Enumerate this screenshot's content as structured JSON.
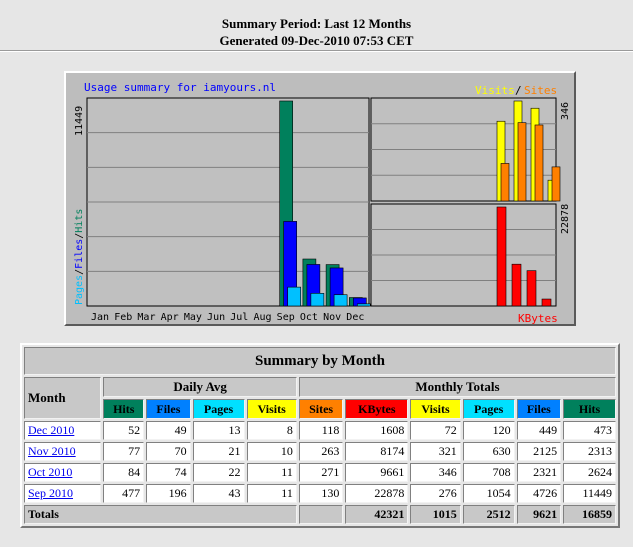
{
  "header": {
    "line1": "Summary Period: Last 12 Months",
    "line2": "Generated 09-Dec-2010 07:53 CET"
  },
  "chart": {
    "title": "Usage summary for iamyours.nl",
    "legend_visits": "Visits",
    "legend_sep": "/",
    "legend_sites": "Sites",
    "left_axis": [
      "Pages",
      "/",
      "Files",
      "/",
      "Hits"
    ],
    "bottom_right_label": "KBytes",
    "colors": {
      "hits": "#00805c",
      "files": "#0000ff",
      "pages": "#00c0ff",
      "visits": "#ffff00",
      "sites": "#ff8000",
      "kbytes": "#ff0000",
      "title": "#0000ff"
    }
  },
  "chart_data": [
    {
      "type": "bar",
      "title": "Usage summary for iamyours.nl",
      "categories": [
        "Jan",
        "Feb",
        "Mar",
        "Apr",
        "May",
        "Jun",
        "Jul",
        "Aug",
        "Sep",
        "Oct",
        "Nov",
        "Dec"
      ],
      "ylim": [
        0,
        11449
      ],
      "ymax_label": "11449",
      "series": [
        {
          "name": "Hits",
          "values": [
            0,
            0,
            0,
            0,
            0,
            0,
            0,
            0,
            11449,
            2624,
            2313,
            473
          ]
        },
        {
          "name": "Files",
          "values": [
            0,
            0,
            0,
            0,
            0,
            0,
            0,
            0,
            4726,
            2321,
            2125,
            449
          ]
        },
        {
          "name": "Pages",
          "values": [
            0,
            0,
            0,
            0,
            0,
            0,
            0,
            0,
            1054,
            708,
            630,
            120
          ]
        }
      ]
    },
    {
      "type": "bar",
      "categories": [
        "Sep",
        "Oct",
        "Nov",
        "Dec"
      ],
      "ylim": [
        0,
        346
      ],
      "ymax_label": "346",
      "series": [
        {
          "name": "Visits",
          "values": [
            276,
            346,
            321,
            72
          ]
        },
        {
          "name": "Sites",
          "values": [
            130,
            271,
            263,
            118
          ]
        }
      ]
    },
    {
      "type": "bar",
      "categories": [
        "Sep",
        "Oct",
        "Nov",
        "Dec"
      ],
      "ylim": [
        0,
        22878
      ],
      "ymax_label": "22878",
      "series": [
        {
          "name": "KBytes",
          "values": [
            22878,
            9661,
            8174,
            1608
          ]
        }
      ]
    }
  ],
  "table": {
    "title": "Summary by Month",
    "month_header": "Month",
    "daily_avg": "Daily Avg",
    "monthly_totals": "Monthly Totals",
    "daily_cols": [
      {
        "label": "Hits",
        "color": "#00805c"
      },
      {
        "label": "Files",
        "color": "#0080ff"
      },
      {
        "label": "Pages",
        "color": "#00e0ff"
      },
      {
        "label": "Visits",
        "color": "#ffff00"
      }
    ],
    "monthly_cols": [
      {
        "label": "Sites",
        "color": "#ff8000"
      },
      {
        "label": "KBytes",
        "color": "#ff0000"
      },
      {
        "label": "Visits",
        "color": "#ffff00"
      },
      {
        "label": "Pages",
        "color": "#00e0ff"
      },
      {
        "label": "Files",
        "color": "#0080ff"
      },
      {
        "label": "Hits",
        "color": "#00805c"
      }
    ],
    "rows": [
      {
        "month": "Dec 2010",
        "vals": [
          "52",
          "49",
          "13",
          "8",
          "118",
          "1608",
          "72",
          "120",
          "449",
          "473"
        ]
      },
      {
        "month": "Nov 2010",
        "vals": [
          "77",
          "70",
          "21",
          "10",
          "263",
          "8174",
          "321",
          "630",
          "2125",
          "2313"
        ]
      },
      {
        "month": "Oct 2010",
        "vals": [
          "84",
          "74",
          "22",
          "11",
          "271",
          "9661",
          "346",
          "708",
          "2321",
          "2624"
        ]
      },
      {
        "month": "Sep 2010",
        "vals": [
          "477",
          "196",
          "43",
          "11",
          "130",
          "22878",
          "276",
          "1054",
          "4726",
          "11449"
        ]
      }
    ],
    "totals": {
      "label": "Totals",
      "vals": [
        "42321",
        "1015",
        "2512",
        "9621",
        "16859"
      ]
    }
  }
}
